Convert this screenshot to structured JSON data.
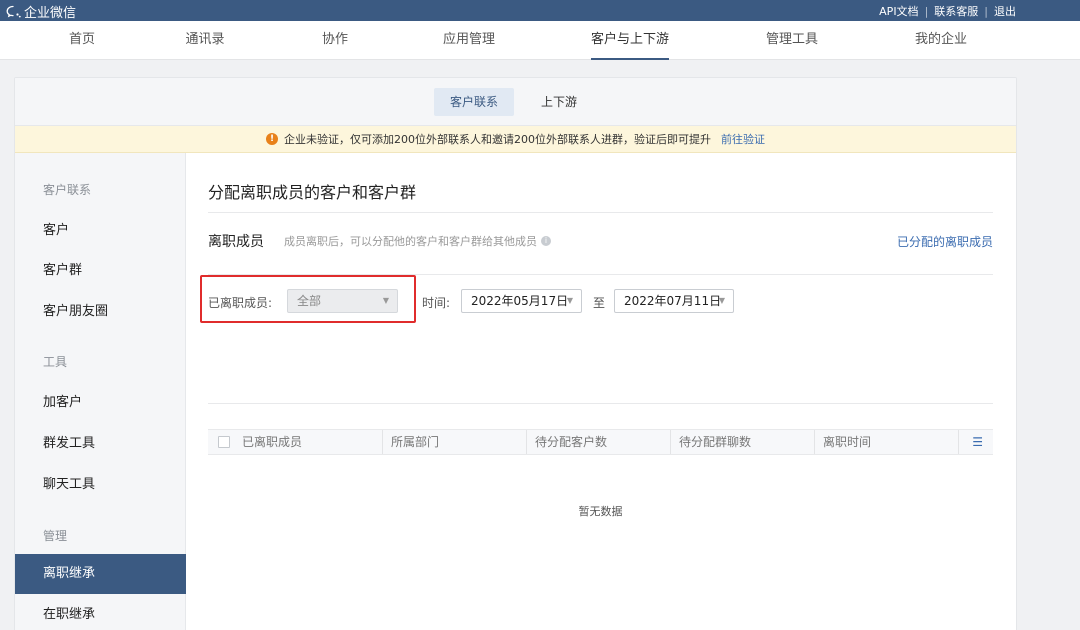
{
  "topbar": {
    "brand": "企业微信",
    "links": [
      "API文档",
      "联系客服",
      "退出"
    ]
  },
  "nav": {
    "items": [
      {
        "label": "首页",
        "active": false
      },
      {
        "label": "通讯录",
        "active": false
      },
      {
        "label": "协作",
        "active": false
      },
      {
        "label": "应用管理",
        "active": false
      },
      {
        "label": "客户与上下游",
        "active": true
      },
      {
        "label": "管理工具",
        "active": false
      },
      {
        "label": "我的企业",
        "active": false
      }
    ]
  },
  "subtabs": [
    {
      "label": "客户联系",
      "active": true
    },
    {
      "label": "上下游",
      "active": false
    }
  ],
  "notice": {
    "text": "企业未验证，仅可添加200位外部联系人和邀请200位外部联系人进群，验证后即可提升",
    "link": "前往验证"
  },
  "sidebar": {
    "groups": [
      {
        "title": "客户联系",
        "items": [
          "客户",
          "客户群",
          "客户朋友圈"
        ]
      },
      {
        "title": "工具",
        "items": [
          "加客户",
          "群发工具",
          "聊天工具"
        ]
      },
      {
        "title": "管理",
        "items": [
          "离职继承",
          "在职继承"
        ]
      }
    ],
    "active_item": "离职继承"
  },
  "main": {
    "title": "分配离职成员的客户和客户群",
    "section_title": "离职成员",
    "section_desc": "成员离职后，可以分配他的客户和客户群给其他成员",
    "assigned_link": "已分配的离职成员",
    "filter": {
      "member_label": "已离职成员:",
      "member_value": "全部",
      "time_label": "时间:",
      "start_date": "2022年05月17日",
      "to_label": "至",
      "end_date": "2022年07月11日"
    },
    "table": {
      "columns": [
        "已离职成员",
        "所属部门",
        "待分配客户数",
        "待分配群聊数",
        "离职时间"
      ],
      "empty_text": "暂无数据"
    }
  },
  "colors": {
    "topbar": "#3b5a82",
    "accent": "#3b5a82",
    "link": "#3b6cb0",
    "highlight_box": "#e02c2c",
    "notice_bg": "#fdf6dc"
  }
}
